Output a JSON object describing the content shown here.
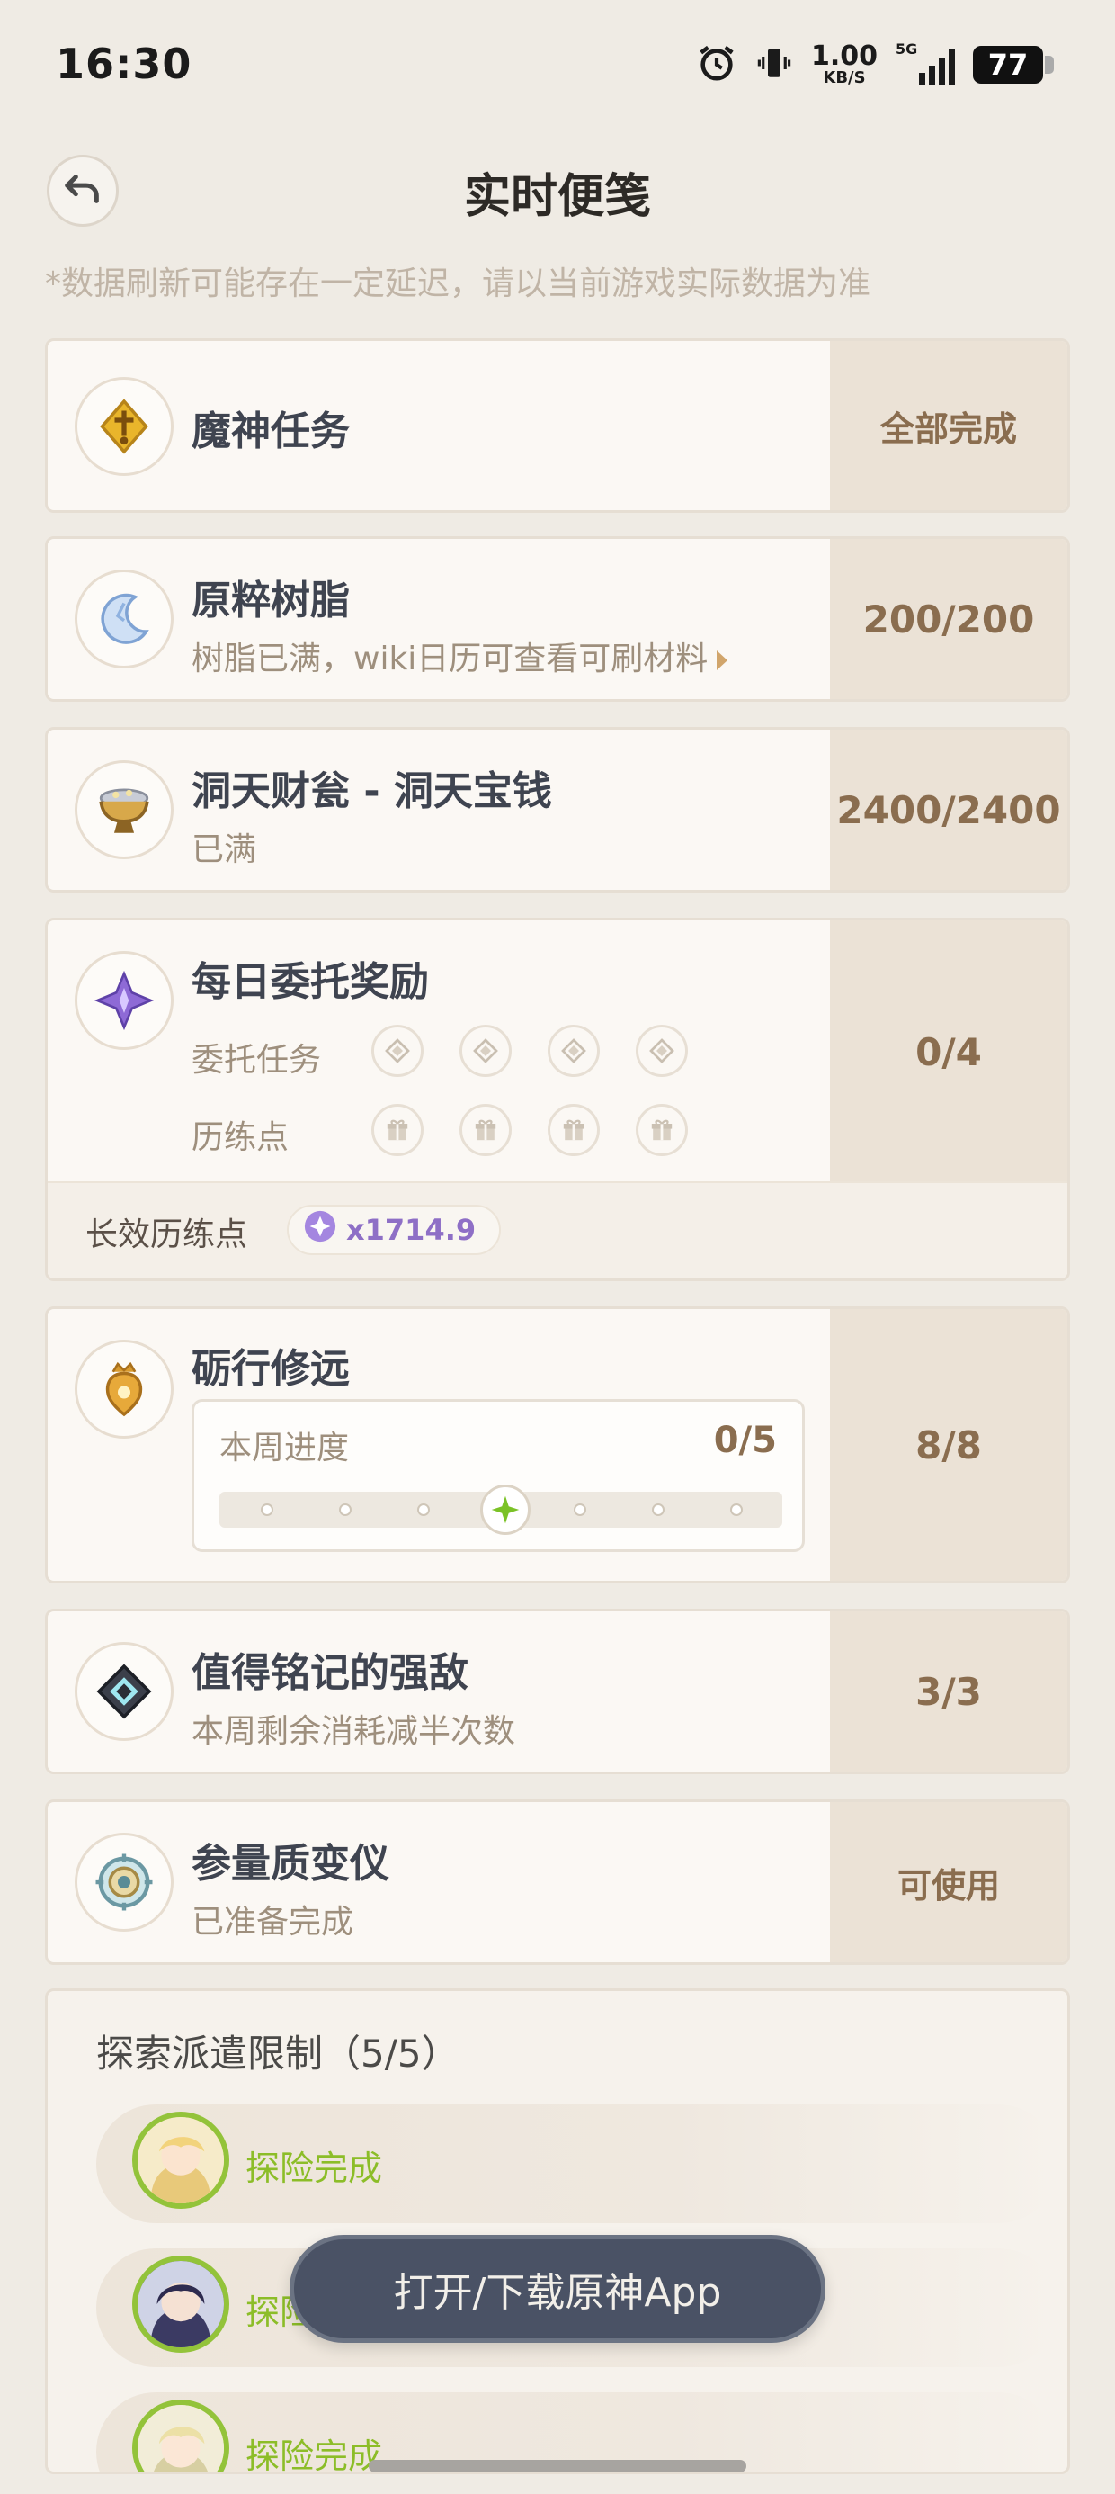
{
  "status_bar": {
    "time": "16:30",
    "net_speed_value": "1.00",
    "net_speed_unit": "KB/S",
    "network": "5G",
    "battery": "77"
  },
  "header": {
    "title": "实时便笺",
    "disclaimer": "*数据刷新可能存在一定延迟，请以当前游戏实际数据为准"
  },
  "cards": {
    "archon_quest": {
      "title": "魔神任务",
      "value": "全部完成",
      "icon": "archon-quest-icon"
    },
    "resin": {
      "title": "原粹树脂",
      "subtitle": "树脂已满，wiki日历可查看可刷材料",
      "value": "200/200",
      "icon": "resin-icon"
    },
    "realm_currency": {
      "title": "洞天财瓮 - 洞天宝钱",
      "subtitle": "已满",
      "value": "2400/2400",
      "icon": "treasure-bowl-icon"
    },
    "daily_commission": {
      "title": "每日委托奖励",
      "value": "0/4",
      "row1_label": "委托任务",
      "row2_label": "历练点",
      "long_label": "长效历练点",
      "long_value": "x1714.9",
      "icon": "commission-star-icon"
    },
    "weekly": {
      "title": "砺行修远",
      "value": "8/8",
      "progress_label": "本周进度",
      "progress_value": "0/5",
      "progress_level": 0,
      "icon": "trial-crest-icon"
    },
    "weekly_boss": {
      "title": "值得铭记的强敌",
      "subtitle": "本周剩余消耗减半次数",
      "value": "3/3",
      "icon": "boss-diamond-icon"
    },
    "transformer": {
      "title": "参量质变仪",
      "subtitle": "已准备完成",
      "value": "可使用",
      "icon": "transformer-icon"
    }
  },
  "expedition": {
    "title": "探索派遣限制（5/5）",
    "rows": [
      {
        "status": "探险完成"
      },
      {
        "status": "探险完成"
      },
      {
        "status": "探险完成"
      }
    ]
  },
  "floating_button": {
    "label": "打开/下载原神App"
  },
  "colors": {
    "accent_brown": "#8a6d4f",
    "complete_green": "#8cbd28",
    "purple": "#8e6fc6"
  }
}
